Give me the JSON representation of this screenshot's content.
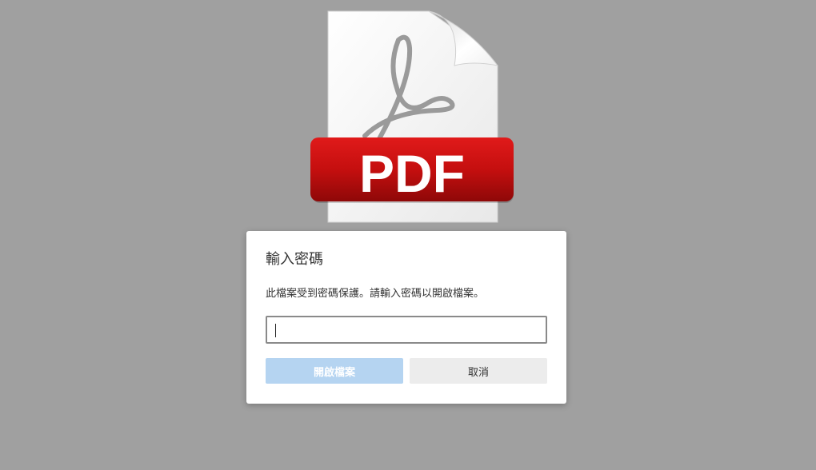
{
  "icon": {
    "name": "pdf-file-icon",
    "badge_text": "PDF",
    "badge_color": "#cc1212",
    "symbol_color": "#9a9a9a"
  },
  "dialog": {
    "title": "輸入密碼",
    "message": "此檔案受到密碼保護。請輸入密碼以開啟檔案。",
    "password_value": "",
    "open_label": "開啟檔案",
    "cancel_label": "取消"
  },
  "colors": {
    "background": "#a0a0a0",
    "open_button_disabled": "#b5d4f1",
    "cancel_button": "#ececec"
  }
}
